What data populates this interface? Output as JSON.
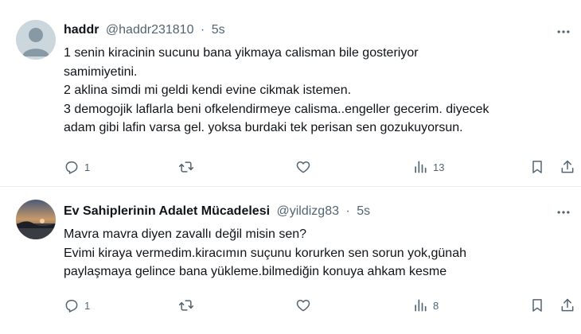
{
  "tweets": [
    {
      "author_name": "haddr",
      "handle": "@haddr231810",
      "separator": "·",
      "time": "5s",
      "lines": [
        "1 senin kiracinin sucunu bana yikmaya calisman bile gosteriyor",
        "samimiyetini.",
        "2 aklina simdi mi geldi kendi evine cikmak istemen.",
        "3 demogojik laflarla beni ofkelendirmeye calisma..engeller gecerim. diyecek",
        "adam gibi lafin varsa gel. yoksa burdaki tek perisan sen gozukuyorsun."
      ],
      "reply_count": "1",
      "views": "13"
    },
    {
      "author_name": "Ev Sahiplerinin Adalet Mücadelesi",
      "handle": "@yildizg83",
      "separator": "·",
      "time": "5s",
      "lines": [
        "Mavra mavra diyen zavallı değil misin sen?",
        "Evimi kiraya vermedim.kiracımın suçunu korurken sen  sorun yok,günah",
        "paylaşmaya gelince bana yükleme.bilmediğin konuya ahkam kesme"
      ],
      "reply_count": "1",
      "views": "8"
    }
  ],
  "icons": {
    "reply": "reply-icon",
    "retweet": "retweet-icon",
    "like": "heart-icon",
    "views": "views-chart-icon",
    "bookmark": "bookmark-icon",
    "share": "share-icon",
    "more": "more-dots-icon"
  },
  "colors": {
    "text_primary": "#0f1419",
    "text_secondary": "#536471",
    "divider": "#e6ecf0"
  }
}
